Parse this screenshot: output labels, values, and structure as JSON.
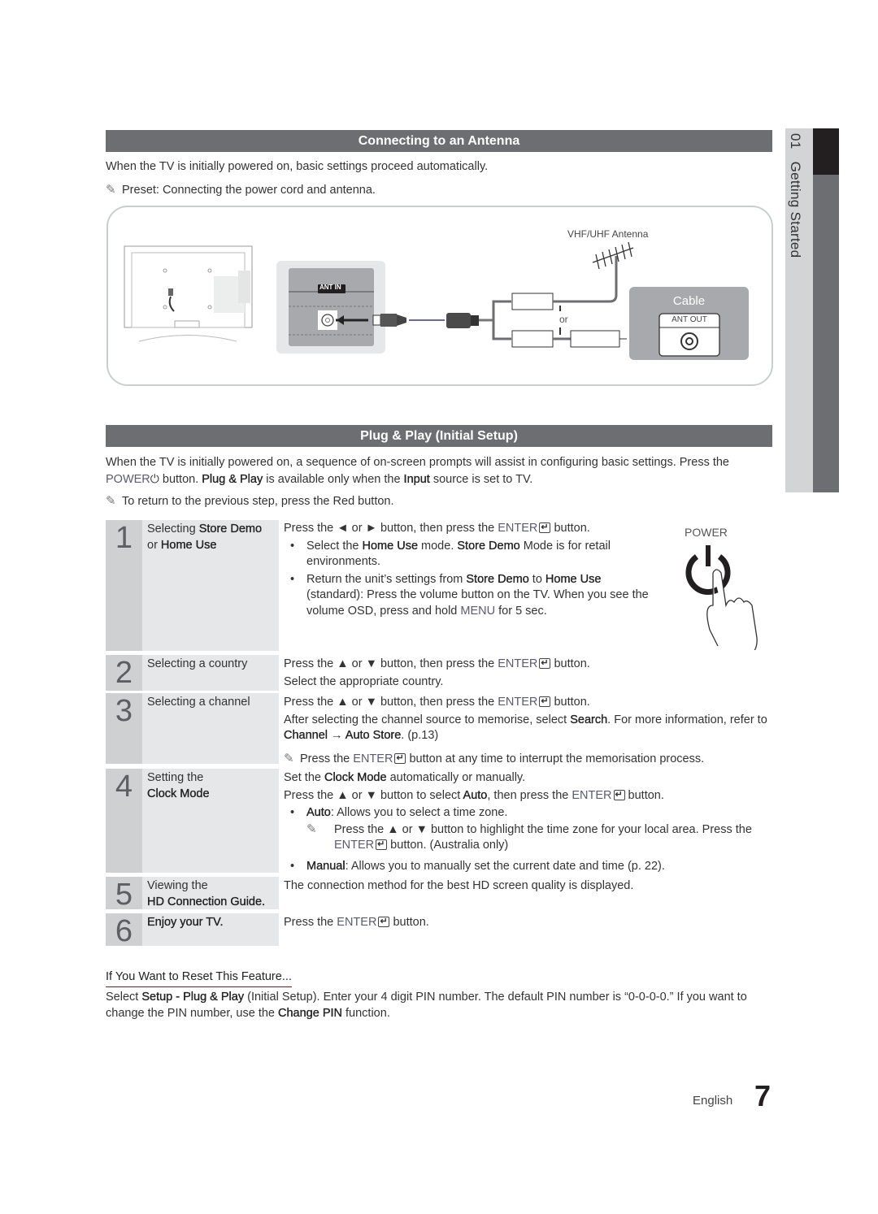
{
  "side_tab": {
    "chapter": "01",
    "title": "Getting Started"
  },
  "antenna_section": {
    "title": "Connecting to an Antenna",
    "intro": "When the TV is initially powered on, basic settings proceed automatically.",
    "note": "Preset: Connecting the power cord and antenna.",
    "diagram": {
      "ant_in_label": "ANT IN",
      "antenna_label": "VHF/UHF Antenna",
      "or_label": "or",
      "cable_label": "Cable",
      "ant_out_label": "ANT OUT"
    }
  },
  "plug_play_section": {
    "title": "Plug & Play (Initial Setup)",
    "intro_1": "When the TV is initially powered on, a sequence of on-screen prompts will assist in configuring basic settings. Press the",
    "intro_power": "POWER",
    "intro_2a": " button. ",
    "intro_2b": "Plug & Play",
    "intro_2c": " is available only when the ",
    "intro_2d": "Input",
    "intro_2e": " source is set to TV.",
    "note": "To return to the previous step, press the Red button.",
    "power_illustration_label": "POWER"
  },
  "steps": [
    {
      "number": "1",
      "title_a": "Selecting ",
      "title_b": "Store Demo",
      "title_c": "or ",
      "title_d": "Home Use",
      "line1_a": "Press the ◄ or ► button, then press the ",
      "enter": "ENTER",
      "line1_b": " button.",
      "bullet1_a": "Select the ",
      "bullet1_b": "Home Use",
      "bullet1_c": " mode. ",
      "bullet1_d": "Store Demo",
      "bullet1_e": " Mode is for retail environments.",
      "bullet2_a": "Return the unit’s settings from ",
      "bullet2_b": "Store Demo",
      "bullet2_c": " to ",
      "bullet2_d": "Home Use",
      "bullet2_e": " (standard): Press the volume button on the TV. When you see the volume OSD, press and hold ",
      "bullet2_f": "MENU",
      "bullet2_g": " for 5 sec."
    },
    {
      "number": "2",
      "title": "Selecting a country",
      "line1_a": "Press the ▲ or ▼ button, then press the ",
      "enter": "ENTER",
      "line1_b": " button.",
      "line2": "Select the appropriate country."
    },
    {
      "number": "3",
      "title": "Selecting a channel",
      "line1_a": "Press the ▲ or ▼ button, then press the ",
      "enter": "ENTER",
      "line1_b": " button.",
      "line2_a": "After selecting the channel source to memorise, select ",
      "line2_b": "Search",
      "line2_c": ". For more information, refer to ",
      "line2_d": "Channel",
      "line2_e": " → ",
      "line2_f": "Auto Store",
      "line2_g": ". (p.13)",
      "note_a": "Press the ",
      "note_b": " button at any time to interrupt the memorisation process."
    },
    {
      "number": "4",
      "title_a": "Setting the",
      "title_b": "Clock Mode",
      "line1_a": "Set the ",
      "line1_b": "Clock Mode",
      "line1_c": " automatically or manually.",
      "line2_a": "Press the ▲ or ▼ button to select ",
      "line2_b": "Auto",
      "line2_c": ", then press the ",
      "enter": "ENTER",
      "line2_d": " button.",
      "bullet1_a": "Auto",
      "bullet1_b": ": Allows you to select a time zone.",
      "note_a": "Press the ▲ or ▼ button to highlight the time zone for your local area. Press the ",
      "note_b": " button. (Australia only)",
      "bullet2_a": "Manual",
      "bullet2_b": ": Allows you to manually set the current date and time (p. 22)."
    },
    {
      "number": "5",
      "title_a": "Viewing the",
      "title_b": "HD Connection Guide.",
      "line1": "The connection method for the best HD screen quality is displayed."
    },
    {
      "number": "6",
      "title": "Enjoy your TV.",
      "line1_a": "Press the ",
      "enter": "ENTER",
      "line1_b": " button."
    }
  ],
  "reset_section": {
    "heading": "If You Want to Reset This Feature...",
    "text_a": "Select ",
    "text_b": "Setup - Plug & Play",
    "text_c": " (Initial Setup). Enter your 4 digit PIN number. The default PIN number is “0-0-0-0.” If you want to change the PIN number, use the ",
    "text_d": "Change PIN",
    "text_e": " function."
  },
  "footer": {
    "language": "English",
    "page_number": "7"
  }
}
